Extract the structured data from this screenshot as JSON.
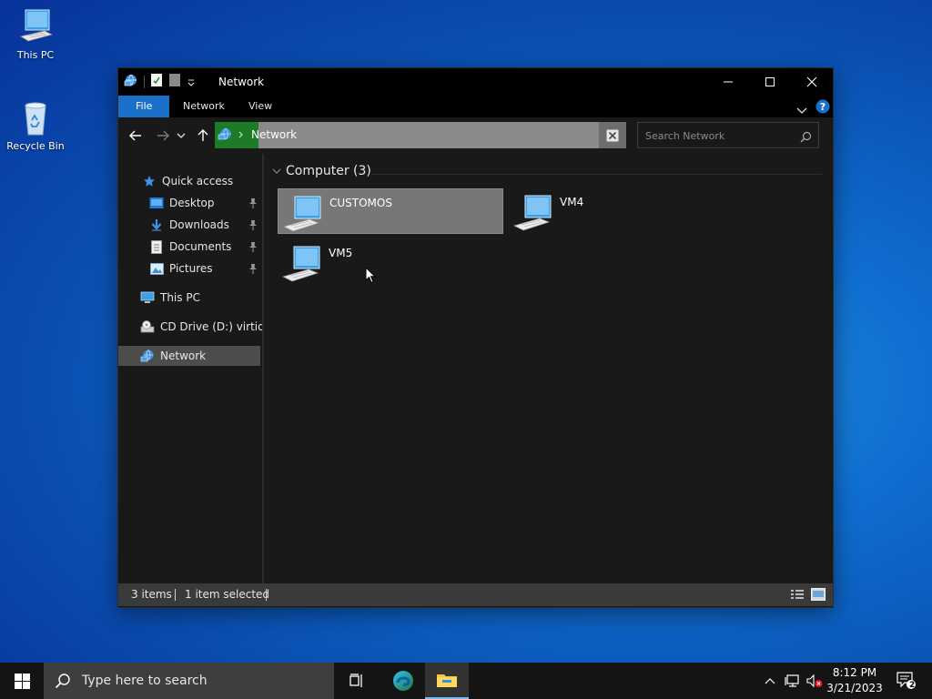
{
  "desktop": {
    "icons": [
      {
        "label": "This PC",
        "icon": "computer-icon"
      },
      {
        "label": "Recycle Bin",
        "icon": "recycle-bin-icon"
      }
    ]
  },
  "window": {
    "title": "Network",
    "ribbon_tabs": [
      "File",
      "Network",
      "View"
    ],
    "address": {
      "path": "Network"
    },
    "search": {
      "placeholder": "Search Network"
    },
    "nav_pane": {
      "items": [
        {
          "label": "Quick access",
          "icon": "star-icon"
        },
        {
          "label": "Desktop",
          "icon": "desktop-folder-icon",
          "pinned": true
        },
        {
          "label": "Downloads",
          "icon": "download-arrow-icon",
          "pinned": true
        },
        {
          "label": "Documents",
          "icon": "documents-icon",
          "pinned": true
        },
        {
          "label": "Pictures",
          "icon": "pictures-icon",
          "pinned": true
        },
        {
          "label": "This PC",
          "icon": "computer-icon"
        },
        {
          "label": "CD Drive (D:) virtio-w",
          "icon": "cd-drive-icon"
        },
        {
          "label": "Network",
          "icon": "network-icon",
          "selected": true
        }
      ]
    },
    "content": {
      "group": {
        "label": "Computer (3)"
      },
      "items": [
        {
          "label": "CUSTOMOS",
          "icon": "computer-icon",
          "selected": true
        },
        {
          "label": "VM4",
          "icon": "computer-icon",
          "selected": false
        },
        {
          "label": "VM5",
          "icon": "computer-icon",
          "selected": false
        }
      ]
    },
    "status": {
      "items_count": "3 items",
      "selection": "1 item selected"
    }
  },
  "taskbar": {
    "search_placeholder": "Type here to search",
    "time": "8:12 PM",
    "date": "3/21/2023",
    "notification_count": "2",
    "accent_color": "#76b9ed"
  },
  "colors": {
    "file_tab": "#1a6fc9",
    "address_icon_bg": "#1d7a27",
    "selection_bg": "#777777"
  }
}
